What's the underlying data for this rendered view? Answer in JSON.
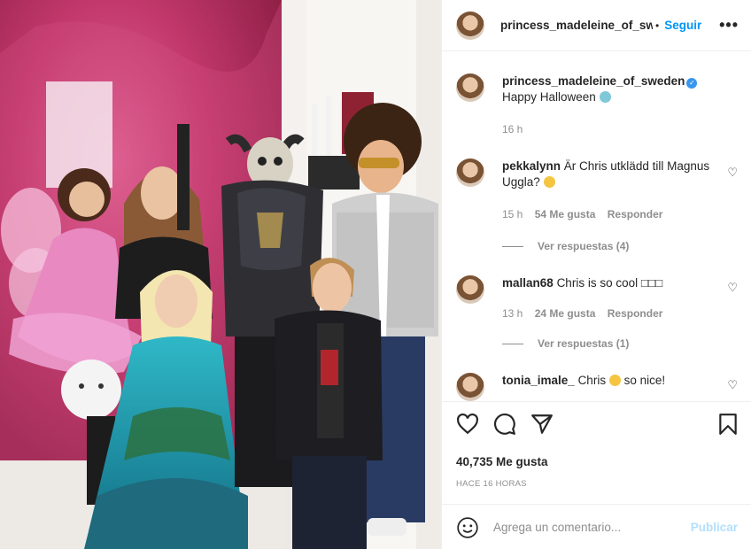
{
  "post": {
    "username": "princess_madeleine_of_sw",
    "separator": "•",
    "follow_label": "Seguir",
    "more_label": "•••"
  },
  "caption": {
    "username": "princess_madeleine_of_sweden",
    "text": "Happy Halloween",
    "time": "16 h"
  },
  "comments": [
    {
      "username": "pekkalynn",
      "text": "Är Chris utklädd till Magnus Uggla?",
      "time": "15 h",
      "likes": "54 Me gusta",
      "reply": "Responder",
      "view_replies": "Ver respuestas (4)"
    },
    {
      "username": "mallan68",
      "text": "Chris is so cool □□□",
      "time": "13 h",
      "likes": "24 Me gusta",
      "reply": "Responder",
      "view_replies": "Ver respuestas (1)"
    },
    {
      "username": "tonia_imale_",
      "text_before": "Chris",
      "text_after": "so nice!"
    }
  ],
  "stats": {
    "likes": "40,735 Me gusta",
    "time_ago": "HACE 16 HORAS"
  },
  "add_comment": {
    "placeholder": "Agrega un comentario...",
    "post_label": "Publicar"
  },
  "icons": [
    "heart-icon",
    "comment-icon",
    "share-icon",
    "bookmark-icon",
    "smiley-icon"
  ],
  "colors": {
    "accent": "#0095f6",
    "post_disabled": "#b2dffc",
    "muted": "#8e8e8e"
  }
}
